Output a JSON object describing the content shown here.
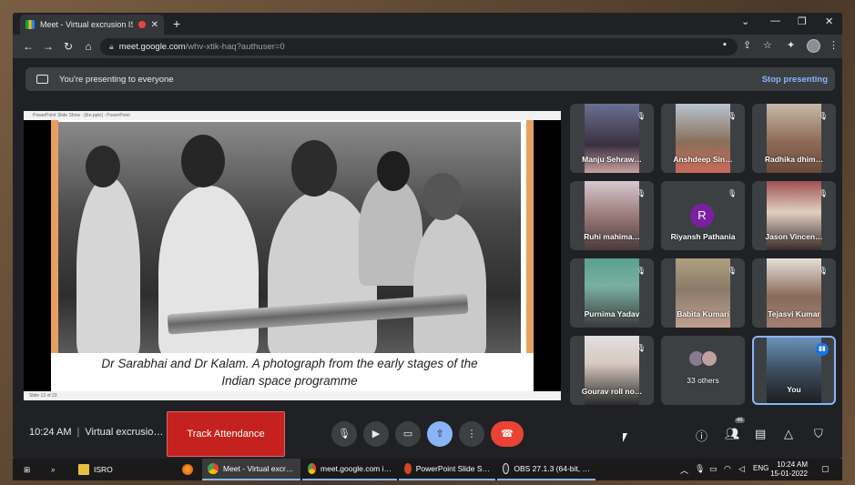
{
  "browser": {
    "tab_title": "Meet - Virtual excrusion ISR",
    "close_tab": "✕",
    "new_tab": "+",
    "url_domain": "meet.google.com",
    "url_path": "/whv-xtik-haq?authuser=0",
    "window_controls": [
      "⌄",
      "—",
      "❐",
      "✕"
    ]
  },
  "presenting": {
    "message": "You're presenting to everyone",
    "stop_label": "Stop presenting"
  },
  "slide": {
    "window_title": "PowerPoint Slide Show - [ibn.pptx] - PowerPoint",
    "caption_line1": "Dr Sarabhai and Dr Kalam. A photograph from the early stages of the",
    "caption_line2": "Indian space programme",
    "status": "Slide 13 of 23"
  },
  "participants": [
    {
      "name": "Manju Sehraw…",
      "muted": true
    },
    {
      "name": "Anshdeep Sin…",
      "muted": true
    },
    {
      "name": "Radhika dhim…",
      "muted": true
    },
    {
      "name": "Ruhi mahima…",
      "muted": true
    },
    {
      "name": "Riyansh Pathania",
      "initial": "R",
      "muted": true
    },
    {
      "name": "Jason Vincen…",
      "muted": true
    },
    {
      "name": "Purnima Yadav",
      "muted": true
    },
    {
      "name": "Babita Kumari",
      "muted": true
    },
    {
      "name": "Tejasvi Kumar",
      "muted": true
    },
    {
      "name": "Gourav roll no…",
      "muted": true
    },
    {
      "name": "33 others"
    },
    {
      "name": "You"
    }
  ],
  "meeting": {
    "time": "10:24 AM",
    "separator": "|",
    "title": "Virtual excrusio…",
    "track_attendance_label": "Track Attendance",
    "people_count": "46"
  },
  "taskbar": {
    "items": [
      {
        "label": "ISRO"
      },
      {
        "label": "Meet - Virtual excr…"
      },
      {
        "label": "meet.google.com i…"
      },
      {
        "label": "PowerPoint Slide S…"
      },
      {
        "label": "OBS 27.1.3 (64-bit, …"
      }
    ],
    "lang": "ENG",
    "clock_time": "10:24 AM",
    "clock_date": "15-01-2022"
  }
}
